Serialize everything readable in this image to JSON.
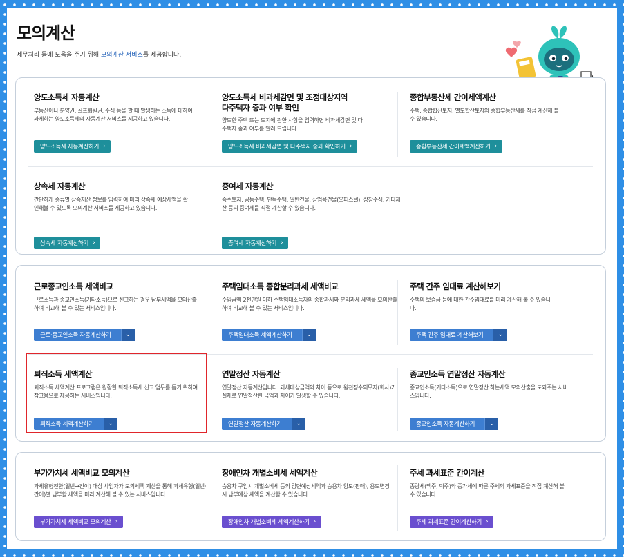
{
  "header": {
    "title": "모의계산",
    "desc_prefix": "세무처리 등에 도움을 주기 위해 ",
    "desc_highlight": "모의계산 서비스",
    "desc_suffix": "를 제공합니다."
  },
  "section1": {
    "cards": [
      {
        "title": "양도소득세 자동계산",
        "desc": "부동산이나 분양권, 골프회원권, 주식 등을 팔 때 발생하는 소득에 대하여 과세하는 양도소득세의 자동계산 서비스를 제공하고 있습니다.",
        "button": "양도소득세 자동계산하기"
      },
      {
        "title": "양도소득세 비과세감면 및 조정대상지역 다주택자 중과 여부 확인",
        "desc": "양도한 주택 또는 토지에 관한 사항을 입력하면 비과세감면 및 다주택자 중과 여부를 알려 드립니다.",
        "button": "양도소득세 비과세감면 및 다주택자 중과 확인하기"
      },
      {
        "title": "종합부동산세 간이세액계산",
        "desc": "주택, 종합합산토지, 별도합산토지의 종합부동산세를 직접 계산해 볼 수 있습니다.",
        "button": "종합부동산세 간이세액계산하기"
      },
      {
        "title": "상속세 자동계산",
        "desc": "간단하게 종류별 상속재산 정보를 입력하여 미리 상속세 예상세액을 확인해볼 수 있도록 모의계산 서비스를 제공하고 있습니다.",
        "button": "상속세 자동계산하기"
      },
      {
        "title": "증여세 자동계산",
        "desc": "승수토지, 공동주택, 단독주택, 일반건물, 상업용건물(오피스텔), 상장주식, 기타재산 등의 증여세를 직접 계산할 수 있습니다.",
        "button": "증여세 자동계산하기"
      }
    ]
  },
  "section2": {
    "cards": [
      {
        "title": "근로종교인소득 세액비교",
        "desc": "근로소득과 종교인소득(기타소득)으로 신고하는 경우 납부세액을 모의산출하여 비교해 볼 수 있는 서비스입니다.",
        "button": "근로·종교인소득 자동계산하기"
      },
      {
        "title": "주택임대소득 종합분리과세 세액비교",
        "desc": "수입금액 2천만원 이하 주택임대소득자의 종합과세와 분리과세 세액을 모의산출하여 비교해 볼 수 있는 서비스입니다.",
        "button": "주택임대소득 세액계산하기"
      },
      {
        "title": "주택 간주 임대료 계산해보기",
        "desc": "주택의 보증금 등에 대한 간주임대료를 미리 계산해 볼 수 있습니다.",
        "button": "주택 간주 임대료 계산해보기"
      },
      {
        "title": "퇴직소득 세액계산",
        "desc": "퇴직소득 세액계산 프로그램은 원활한 퇴직소득세 신고 업무를 돕기 위하여 참고용으로 제공하는 서비스입니다.",
        "button": "퇴직소득 세액계산하기"
      },
      {
        "title": "연말정산 자동계산",
        "desc": "연말정산 자동계산입니다. 과세대상금액의 차이 등으로 원천징수의무자(회사)가 실제로 연말정산한 금액과 차이가 발생할 수 있습니다.",
        "button": "연말정산 자동계산하기"
      },
      {
        "title": "종교인소득 연말정산 자동계산",
        "desc": "종교인소득(기타소득)으로 연말정산 하는세액 모의산출을 도와주는 서비스입니다.",
        "button": "종교인소득 자동계산하기"
      }
    ]
  },
  "section3": {
    "cards": [
      {
        "title": "부가가치세 세액비교 모의계산",
        "desc": "과세유형전환(일반→간이) 대상 사업자가 모의세액 계산을 통해 과세유형(일반·간이)별 납부할 세액을 미리 계산해 볼 수 있는 서비스입니다.",
        "button": "부가가치세 세액비교 모의계산"
      },
      {
        "title": "장애인차 개별소비세 세액계산",
        "desc": "승용차 구입시 개별소비세 등의 감면예상세액과 승용차 양도(판매), 용도변경시 납부예상 세액을 계산할 수 있습니다.",
        "button": "장애인차 개별소비세 세액계산하기"
      },
      {
        "title": "주세 과세표준 간이계산",
        "desc": "종량세(맥주, 탁주)와 종가세에 따른 주세의 과세표준을 직접 계산해 볼 수 있습니다.",
        "button": "주세 과세표준 간이계산하기"
      }
    ]
  },
  "icons": {
    "chevron": "chevron-right-icon",
    "dropdown": "chevron-down-icon"
  },
  "colors": {
    "teal": "#1e8f9b",
    "purple": "#6a4fcf",
    "blue": "#3d7ed1",
    "highlight": "#e0262b"
  }
}
